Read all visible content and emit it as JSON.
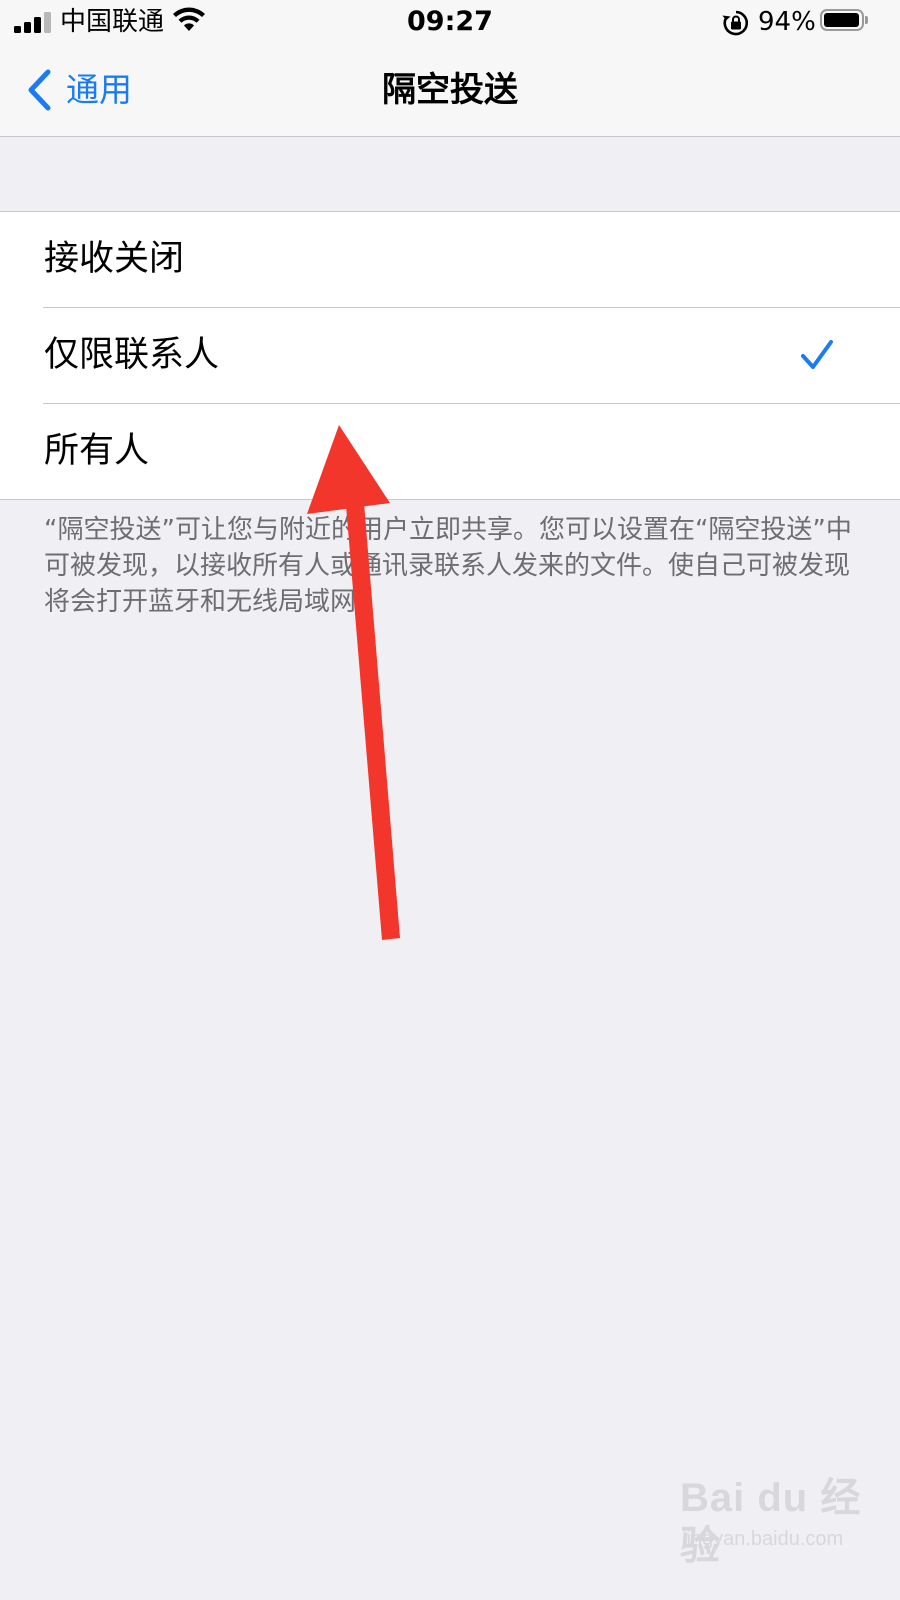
{
  "status_bar": {
    "carrier": "中国联通",
    "time": "09:27",
    "battery_percent": "94%",
    "battery_level": 0.94,
    "signal_bars": 3,
    "icons": [
      "signal-icon",
      "wifi-icon",
      "rotation-lock-icon",
      "battery-icon"
    ]
  },
  "nav": {
    "back_label": "通用",
    "title": "隔空投送"
  },
  "options": [
    {
      "label": "接收关闭",
      "selected": false
    },
    {
      "label": "仅限联系人",
      "selected": true
    },
    {
      "label": "所有人",
      "selected": false
    }
  ],
  "footer": {
    "text": "“隔空投送”可让您与附近的用户立即共享。您可以设置在“隔空投送”中可被发现，以接收所有人或通讯录联系人发来的文件。使自己可被发现将会打开蓝牙和无线局域网。"
  },
  "watermark": {
    "logo": "Bai du 经验",
    "url": "jingyan.baidu.com"
  },
  "colors": {
    "accent": "#1a7cf0",
    "annotation_arrow": "#f2362b",
    "background": "#efeff4"
  }
}
